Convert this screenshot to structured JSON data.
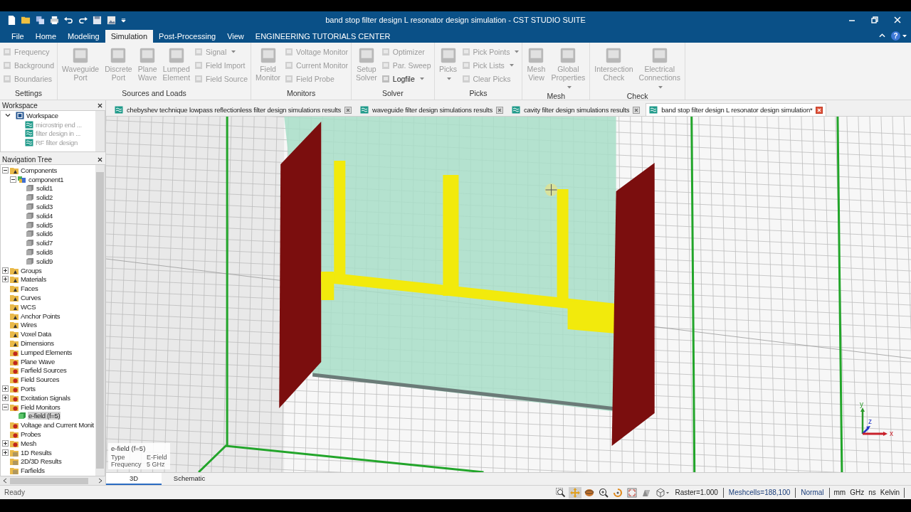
{
  "window": {
    "title": "band stop filter design L  resonator design simulation - CST STUDIO SUITE",
    "help_label": "?"
  },
  "ribbon_tabs": [
    {
      "label": "File",
      "selected": false
    },
    {
      "label": "Home",
      "selected": false
    },
    {
      "label": "Modeling",
      "selected": false
    },
    {
      "label": "Simulation",
      "selected": true
    },
    {
      "label": "Post-Processing",
      "selected": false
    },
    {
      "label": "View",
      "selected": false
    },
    {
      "label": "ENGINEERING TUTORIALS CENTER",
      "selected": false
    }
  ],
  "ribbon_groups": [
    {
      "label": "Settings",
      "items": [
        {
          "label": "Frequency",
          "kind": "small",
          "dropdown": false,
          "disabled": true
        },
        {
          "label": "Background",
          "kind": "small",
          "dropdown": false,
          "disabled": true
        },
        {
          "label": "Boundaries",
          "kind": "small",
          "dropdown": false,
          "disabled": true
        }
      ]
    },
    {
      "label": "Sources and Loads",
      "items": [
        {
          "label": "Waveguide Port",
          "kind": "large",
          "dropdown": false,
          "disabled": true
        },
        {
          "label": "Discrete Port",
          "kind": "large",
          "dropdown": false,
          "disabled": true
        },
        {
          "label": "Plane Wave",
          "kind": "large",
          "dropdown": false,
          "disabled": true
        },
        {
          "label": "Lumped Element",
          "kind": "large",
          "dropdown": false,
          "disabled": true
        },
        {
          "label": "Signal",
          "kind": "small",
          "dropdown": true,
          "disabled": true
        },
        {
          "label": "Field Import",
          "kind": "small",
          "dropdown": false,
          "disabled": true
        },
        {
          "label": "Field Source",
          "kind": "small",
          "dropdown": false,
          "disabled": true
        }
      ]
    },
    {
      "label": "Monitors",
      "items": [
        {
          "label": "Field Monitor",
          "kind": "large",
          "dropdown": false,
          "disabled": true
        },
        {
          "label": "Voltage Monitor",
          "kind": "small",
          "dropdown": false,
          "disabled": true
        },
        {
          "label": "Current Monitor",
          "kind": "small",
          "dropdown": false,
          "disabled": true
        },
        {
          "label": "Field Probe",
          "kind": "small",
          "dropdown": false,
          "disabled": true
        }
      ]
    },
    {
      "label": "Solver",
      "items": [
        {
          "label": "Setup Solver",
          "kind": "large",
          "dropdown": false,
          "disabled": true
        },
        {
          "label": "Optimizer",
          "kind": "small",
          "dropdown": false,
          "disabled": true
        },
        {
          "label": "Par. Sweep",
          "kind": "small",
          "dropdown": false,
          "disabled": true
        },
        {
          "label": "Logfile",
          "kind": "small",
          "dropdown": true,
          "disabled": false
        }
      ]
    },
    {
      "label": "Picks",
      "items": [
        {
          "label": "Picks",
          "kind": "large",
          "dropdown": true,
          "disabled": true
        },
        {
          "label": "Pick Points",
          "kind": "small",
          "dropdown": true,
          "disabled": true
        },
        {
          "label": "Pick Lists",
          "kind": "small",
          "dropdown": true,
          "disabled": true
        },
        {
          "label": "Clear Picks",
          "kind": "small",
          "dropdown": false,
          "disabled": true
        }
      ]
    },
    {
      "label": "Mesh",
      "items": [
        {
          "label": "Mesh View",
          "kind": "large",
          "dropdown": false,
          "disabled": true
        },
        {
          "label": "Global Properties",
          "kind": "large",
          "dropdown": true,
          "disabled": true
        }
      ]
    },
    {
      "label": "Check",
      "items": [
        {
          "label": "Intersection Check",
          "kind": "large",
          "dropdown": false,
          "disabled": true
        },
        {
          "label": "Electrical Connections",
          "kind": "large",
          "dropdown": true,
          "disabled": true
        }
      ]
    }
  ],
  "workspace_panel": {
    "title": "Workspace",
    "root": {
      "label": "Workspace",
      "kind": "workspace",
      "expanded": true,
      "selected": false,
      "children": [
        {
          "label": "microstrip end ...",
          "kind": "document",
          "selected": false
        },
        {
          "label": "filter design in ...",
          "kind": "document",
          "selected": false
        },
        {
          "label": "RF filter design",
          "kind": "document",
          "selected": false
        }
      ]
    }
  },
  "nav_tree": {
    "title": "Navigation Tree",
    "items": [
      {
        "label": "Components",
        "kind": "group",
        "expanded": true,
        "selected": false,
        "children": [
          {
            "label": "component1",
            "kind": "component",
            "expanded": true,
            "selected": false,
            "children": [
              {
                "label": "solid1",
                "kind": "solid",
                "selected": false
              },
              {
                "label": "solid2",
                "kind": "solid",
                "selected": false
              },
              {
                "label": "solid3",
                "kind": "solid",
                "selected": false
              },
              {
                "label": "solid4",
                "kind": "solid",
                "selected": false
              },
              {
                "label": "solid5",
                "kind": "solid",
                "selected": false
              },
              {
                "label": "solid6",
                "kind": "solid",
                "selected": false
              },
              {
                "label": "solid7",
                "kind": "solid",
                "selected": false
              },
              {
                "label": "solid8",
                "kind": "solid",
                "selected": false
              },
              {
                "label": "solid9",
                "kind": "solid",
                "selected": false
              }
            ]
          }
        ]
      },
      {
        "label": "Groups",
        "kind": "group",
        "expanded": false,
        "selected": false
      },
      {
        "label": "Materials",
        "kind": "group",
        "expanded": false,
        "selected": false
      },
      {
        "label": "Faces",
        "kind": "group",
        "selected": false
      },
      {
        "label": "Curves",
        "kind": "group",
        "selected": false
      },
      {
        "label": "WCS",
        "kind": "group",
        "selected": false
      },
      {
        "label": "Anchor Points",
        "kind": "group",
        "selected": false
      },
      {
        "label": "Wires",
        "kind": "group",
        "selected": false
      },
      {
        "label": "Voxel Data",
        "kind": "group",
        "selected": false
      },
      {
        "label": "Dimensions",
        "kind": "group",
        "selected": false
      },
      {
        "label": "Lumped Elements",
        "kind": "source",
        "selected": false
      },
      {
        "label": "Plane Wave",
        "kind": "source",
        "selected": false
      },
      {
        "label": "Farfield Sources",
        "kind": "source",
        "selected": false
      },
      {
        "label": "Field Sources",
        "kind": "source",
        "selected": false
      },
      {
        "label": "Ports",
        "kind": "source",
        "expanded": false,
        "selected": false
      },
      {
        "label": "Excitation Signals",
        "kind": "source",
        "expanded": false,
        "selected": false
      },
      {
        "label": "Field Monitors",
        "kind": "source",
        "expanded": true,
        "selected": false,
        "children": [
          {
            "label": "e-field (f=5)",
            "kind": "monitor",
            "selected": true
          }
        ]
      },
      {
        "label": "Voltage and Current Monit",
        "kind": "source",
        "selected": false
      },
      {
        "label": "Probes",
        "kind": "source",
        "selected": false
      },
      {
        "label": "Mesh",
        "kind": "source",
        "expanded": false,
        "selected": false
      },
      {
        "label": "1D Results",
        "kind": "result",
        "expanded": false,
        "selected": false
      },
      {
        "label": "2D/3D Results",
        "kind": "result",
        "selected": false
      },
      {
        "label": "Farfields",
        "kind": "result",
        "selected": false
      }
    ]
  },
  "doc_tabs": [
    {
      "label": "chebyshev technique lowpass reflectionless filter design simulations results",
      "selected": false
    },
    {
      "label": "waveguide filter design simulations results",
      "selected": false
    },
    {
      "label": "cavity filter design simulations results",
      "selected": false
    },
    {
      "label": "band stop filter design L  resonator design simulation*",
      "selected": true
    }
  ],
  "viewport": {
    "monitor_info": {
      "title": "e-field (f=5)",
      "rows": [
        {
          "label": "Type",
          "value": "E-Field"
        },
        {
          "label": "Frequency",
          "value": "5 GHz"
        }
      ]
    },
    "axes": {
      "x": "x",
      "y": "y",
      "z": "z"
    }
  },
  "view_tabs": [
    {
      "label": "3D",
      "selected": true
    },
    {
      "label": "Schematic",
      "selected": false
    }
  ],
  "status_bar": {
    "message": "Ready",
    "view_tools": [
      {
        "kind": "zoom-box",
        "selected": false
      },
      {
        "kind": "pan",
        "selected": true
      },
      {
        "kind": "rotate",
        "selected": false
      },
      {
        "kind": "zoom",
        "selected": false
      },
      {
        "kind": "spin",
        "selected": false
      },
      {
        "kind": "fit",
        "selected": false
      },
      {
        "kind": "shade",
        "selected": false
      },
      {
        "kind": "view",
        "selected": false
      }
    ],
    "raster": "Raster=1.000",
    "meshcells": "Meshcells=188,100",
    "mode": "Normal",
    "units": [
      "mm",
      "GHz",
      "ns",
      "Kelvin"
    ]
  }
}
